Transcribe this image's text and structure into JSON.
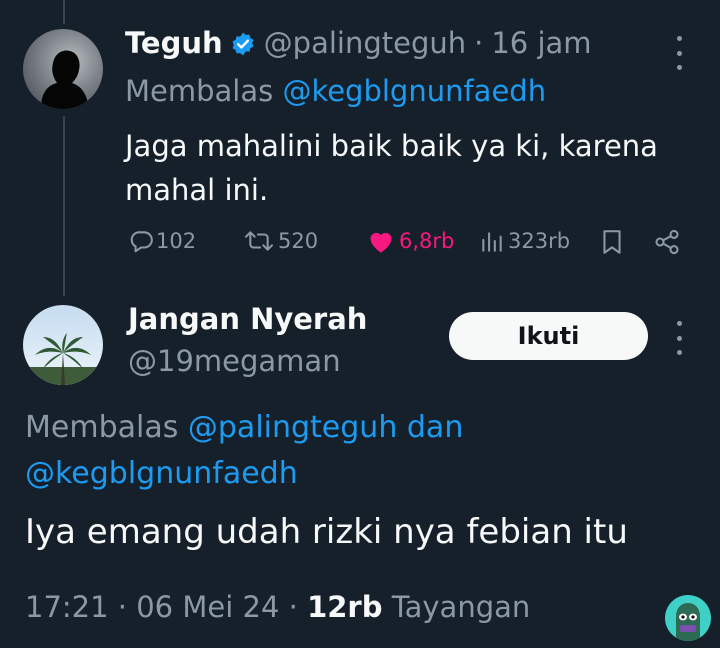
{
  "tweet_parent": {
    "display_name": "Teguh",
    "handle": "@palingteguh",
    "separator": "·",
    "time_ago": "16 jam",
    "replying_prefix": "Membalas",
    "replying_to": "@kegblgnunfaedh",
    "text": "Jaga mahalini baik baik ya ki, karena mahal ini.",
    "stats": {
      "replies": "102",
      "reposts": "520",
      "likes": "6,8rb",
      "views": "323rb"
    },
    "colors": {
      "like": "#f91880",
      "link": "#1d9bf0",
      "verified": "#1d9bf0"
    }
  },
  "tweet_main": {
    "display_name": "Jangan Nyerah",
    "handle": "@19megaman",
    "follow_label": "Ikuti",
    "replying_prefix": "Membalas",
    "replying_to_1": "@palingteguh",
    "replying_joiner": "dan",
    "replying_to_2": "@kegblgnunfaedh",
    "text": "Iya emang udah rizki nya febian itu",
    "time": "17:21",
    "separator": "·",
    "date": "06 Mei 24",
    "views_count": "12rb",
    "views_label": "Tayangan"
  },
  "icons": [
    "verified-badge-icon",
    "more-options-icon",
    "reply-icon",
    "repost-icon",
    "like-heart-icon",
    "views-chart-icon",
    "bookmark-icon",
    "share-icon"
  ],
  "theme": {
    "background": "#15202b",
    "text": "#f7f9f9",
    "muted": "#8b98a5"
  }
}
